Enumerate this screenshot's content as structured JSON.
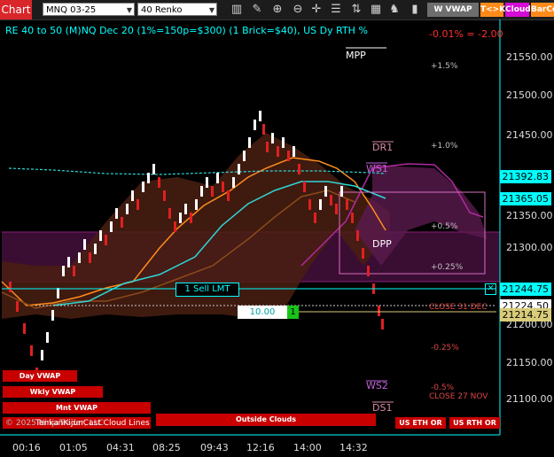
{
  "toolbar": {
    "chart_tab": "Chart",
    "instrument": "MNQ 03-25",
    "bar_type": "40 Renko",
    "icons": [
      "bars-icon",
      "pencil-icon",
      "zoom-in-icon",
      "zoom-out-icon",
      "crosshair-icon",
      "properties-icon",
      "chart-trader-icon",
      "data-box-icon",
      "strategy-icon",
      "indicators-icon"
    ],
    "btn_vwap": "W VWAP",
    "btn_tk": "T<>K",
    "btn_cloud": "Cloud",
    "btn_bar": "BarCo"
  },
  "chart": {
    "header": "RE 40 to 50 (M)NQ Dec 20 (1%=150p=$300) (1 Brick=$40), US Dy RTH %",
    "change_text": "-0.01% = -2.00",
    "pct_labels": [
      "+1.5%",
      "+1.0%",
      "+0.5%",
      "+0.25%",
      "-0.25%",
      "-0.5%"
    ],
    "level_labels": [
      "MPP",
      "DR1",
      "WS1",
      "DPP",
      "WS2",
      "DS1"
    ],
    "sell_order": "1 Sell LMT",
    "qty_value": "10.00",
    "qty_count": "1",
    "close_31": "CLOSE 31 DEC",
    "close_27": "CLOSE 27 NOV",
    "copyright": "© 2025 NinjaTrader, LLC",
    "overlay_text": "TenkanKijunCast Cloud Lines",
    "bars": {
      "day_vwap": "Day VWAP",
      "wkly_vwap": "Wkly VWAP",
      "mnt_vwap": "Mnt VWAP",
      "outside_clouds": "Outside Clouds",
      "us_eth": "US ETH OR",
      "us_rth": "US RTH OR"
    },
    "x_labels": [
      "00:16",
      "01:05",
      "04:31",
      "08:25",
      "09:43",
      "12:16",
      "14:00",
      "14:32"
    ],
    "y_ticks": [
      "21550.00",
      "21500.00",
      "21450.00",
      "21350.00",
      "21300.00",
      "21200.00",
      "21150.00",
      "21100.00"
    ],
    "price_tags": {
      "p1": "21392.83",
      "p2": "21365.05",
      "p3": "21244.75",
      "p4": "21224.50",
      "p5": "21214.75"
    }
  },
  "colors": {
    "accent": "#00ffff",
    "sell_red": "#d8262a",
    "wvwap": "#9e9e9e",
    "tk": "#ff8c1a",
    "cloud": "#d50cd5"
  }
}
